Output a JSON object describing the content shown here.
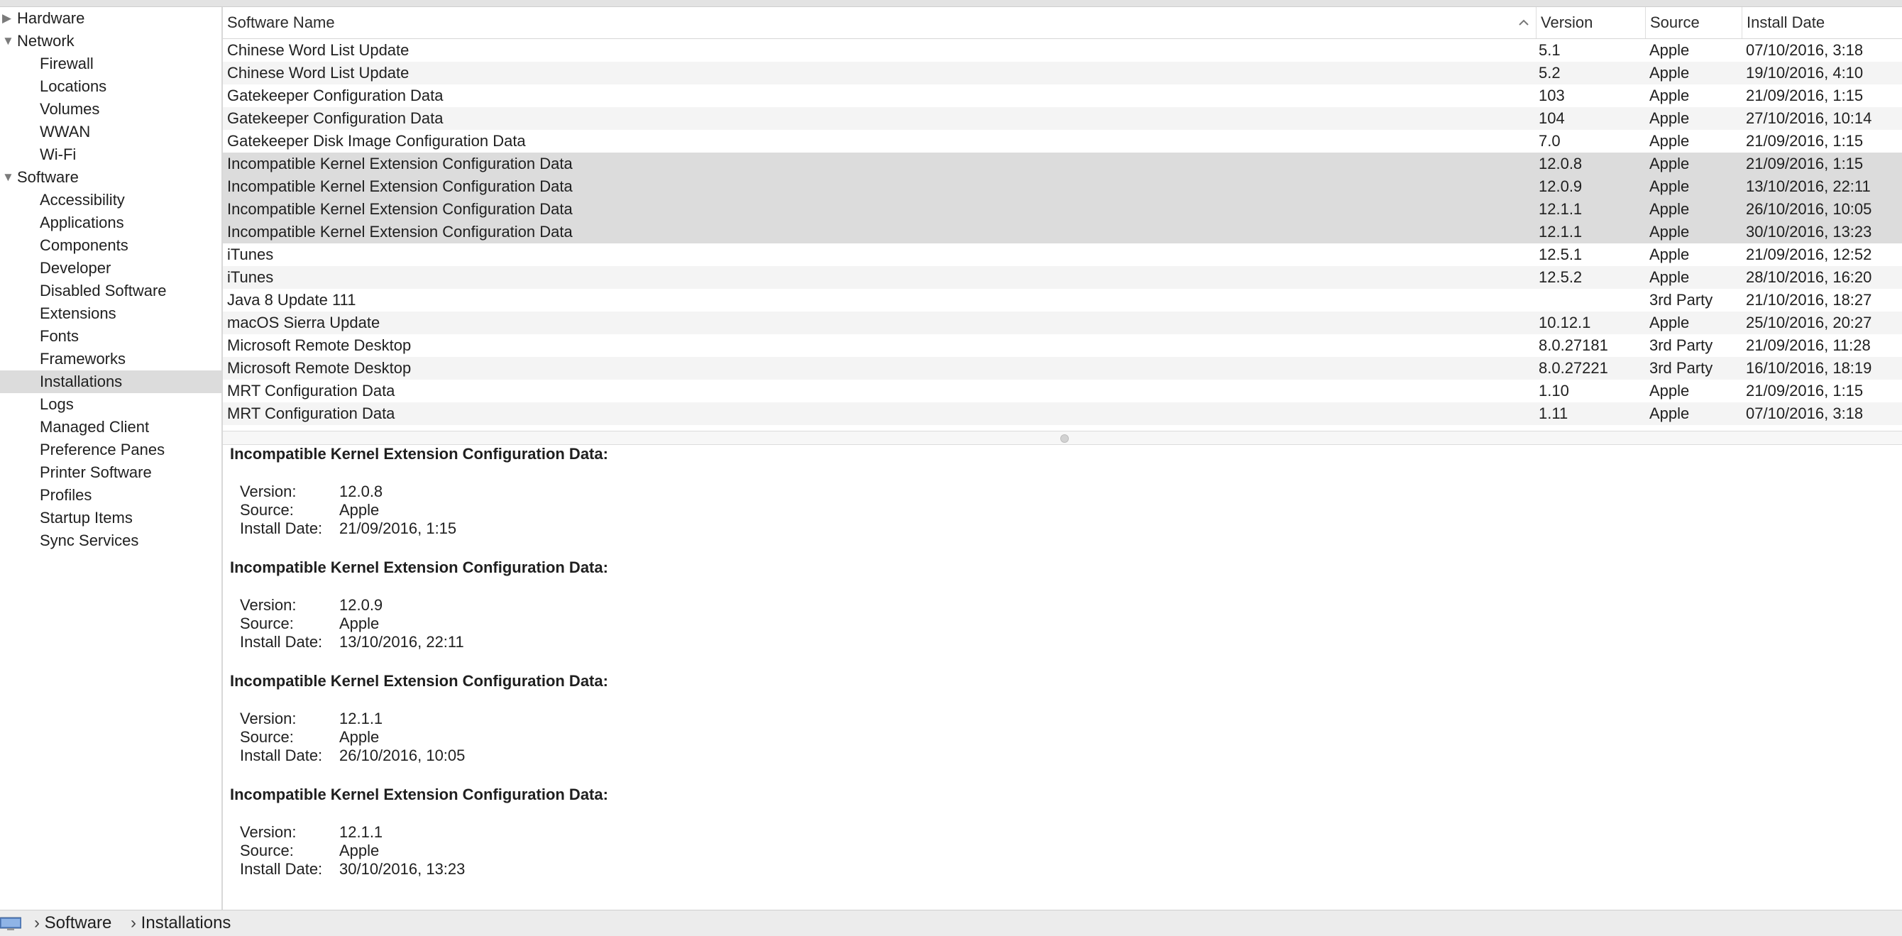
{
  "sidebar": {
    "items": [
      {
        "label": "Hardware",
        "level": 0,
        "expanded": false
      },
      {
        "label": "Network",
        "level": 0,
        "expanded": true
      },
      {
        "label": "Firewall",
        "level": 1
      },
      {
        "label": "Locations",
        "level": 1
      },
      {
        "label": "Volumes",
        "level": 1
      },
      {
        "label": "WWAN",
        "level": 1
      },
      {
        "label": "Wi-Fi",
        "level": 1
      },
      {
        "label": "Software",
        "level": 0,
        "expanded": true
      },
      {
        "label": "Accessibility",
        "level": 1
      },
      {
        "label": "Applications",
        "level": 1
      },
      {
        "label": "Components",
        "level": 1
      },
      {
        "label": "Developer",
        "level": 1
      },
      {
        "label": "Disabled Software",
        "level": 1
      },
      {
        "label": "Extensions",
        "level": 1
      },
      {
        "label": "Fonts",
        "level": 1
      },
      {
        "label": "Frameworks",
        "level": 1
      },
      {
        "label": "Installations",
        "level": 1,
        "selected": true
      },
      {
        "label": "Logs",
        "level": 1
      },
      {
        "label": "Managed Client",
        "level": 1
      },
      {
        "label": "Preference Panes",
        "level": 1
      },
      {
        "label": "Printer Software",
        "level": 1
      },
      {
        "label": "Profiles",
        "level": 1
      },
      {
        "label": "Startup Items",
        "level": 1
      },
      {
        "label": "Sync Services",
        "level": 1
      }
    ]
  },
  "table": {
    "columns": {
      "name": "Software Name",
      "version": "Version",
      "source": "Source",
      "date": "Install Date"
    },
    "sort_icon": "chevron-up-icon",
    "rows": [
      {
        "name": "Chinese Word List Update",
        "version": "5.1",
        "source": "Apple",
        "date": "07/10/2016, 3:18"
      },
      {
        "name": "Chinese Word List Update",
        "version": "5.2",
        "source": "Apple",
        "date": "19/10/2016, 4:10"
      },
      {
        "name": "Gatekeeper Configuration Data",
        "version": "103",
        "source": "Apple",
        "date": "21/09/2016, 1:15"
      },
      {
        "name": "Gatekeeper Configuration Data",
        "version": "104",
        "source": "Apple",
        "date": "27/10/2016, 10:14"
      },
      {
        "name": "Gatekeeper Disk Image Configuration Data",
        "version": "7.0",
        "source": "Apple",
        "date": "21/09/2016, 1:15"
      },
      {
        "name": "Incompatible Kernel Extension Configuration Data",
        "version": "12.0.8",
        "source": "Apple",
        "date": "21/09/2016, 1:15",
        "selected": true
      },
      {
        "name": "Incompatible Kernel Extension Configuration Data",
        "version": "12.0.9",
        "source": "Apple",
        "date": "13/10/2016, 22:11",
        "selected": true
      },
      {
        "name": "Incompatible Kernel Extension Configuration Data",
        "version": "12.1.1",
        "source": "Apple",
        "date": "26/10/2016, 10:05",
        "selected": true
      },
      {
        "name": "Incompatible Kernel Extension Configuration Data",
        "version": "12.1.1",
        "source": "Apple",
        "date": "30/10/2016, 13:23",
        "selected": true
      },
      {
        "name": "iTunes",
        "version": "12.5.1",
        "source": "Apple",
        "date": "21/09/2016, 12:52"
      },
      {
        "name": "iTunes",
        "version": "12.5.2",
        "source": "Apple",
        "date": "28/10/2016, 16:20"
      },
      {
        "name": "Java 8 Update 111",
        "version": "",
        "source": "3rd Party",
        "date": "21/10/2016, 18:27"
      },
      {
        "name": "macOS Sierra Update",
        "version": "10.12.1",
        "source": "Apple",
        "date": "25/10/2016, 20:27"
      },
      {
        "name": "Microsoft Remote Desktop",
        "version": "8.0.27181",
        "source": "3rd Party",
        "date": "21/09/2016, 11:28"
      },
      {
        "name": "Microsoft Remote Desktop",
        "version": "8.0.27221",
        "source": "3rd Party",
        "date": "16/10/2016, 18:19"
      },
      {
        "name": "MRT Configuration Data",
        "version": "1.10",
        "source": "Apple",
        "date": "21/09/2016, 1:15"
      },
      {
        "name": "MRT Configuration Data",
        "version": "1.11",
        "source": "Apple",
        "date": "07/10/2016, 3:18"
      }
    ]
  },
  "detail": {
    "labels": {
      "version": "Version:",
      "source": "Source:",
      "date": "Install Date:"
    },
    "entries": [
      {
        "title": "Incompatible Kernel Extension Configuration Data:",
        "version": "12.0.8",
        "source": "Apple",
        "date": "21/09/2016, 1:15"
      },
      {
        "title": "Incompatible Kernel Extension Configuration Data:",
        "version": "12.0.9",
        "source": "Apple",
        "date": "13/10/2016, 22:11"
      },
      {
        "title": "Incompatible Kernel Extension Configuration Data:",
        "version": "12.1.1",
        "source": "Apple",
        "date": "26/10/2016, 10:05"
      },
      {
        "title": "Incompatible Kernel Extension Configuration Data:",
        "version": "12.1.1",
        "source": "Apple",
        "date": "30/10/2016, 13:23"
      }
    ]
  },
  "pathbar": {
    "icon": "computer-icon",
    "separator": "›",
    "crumbs": [
      "Software",
      "Installations"
    ]
  }
}
